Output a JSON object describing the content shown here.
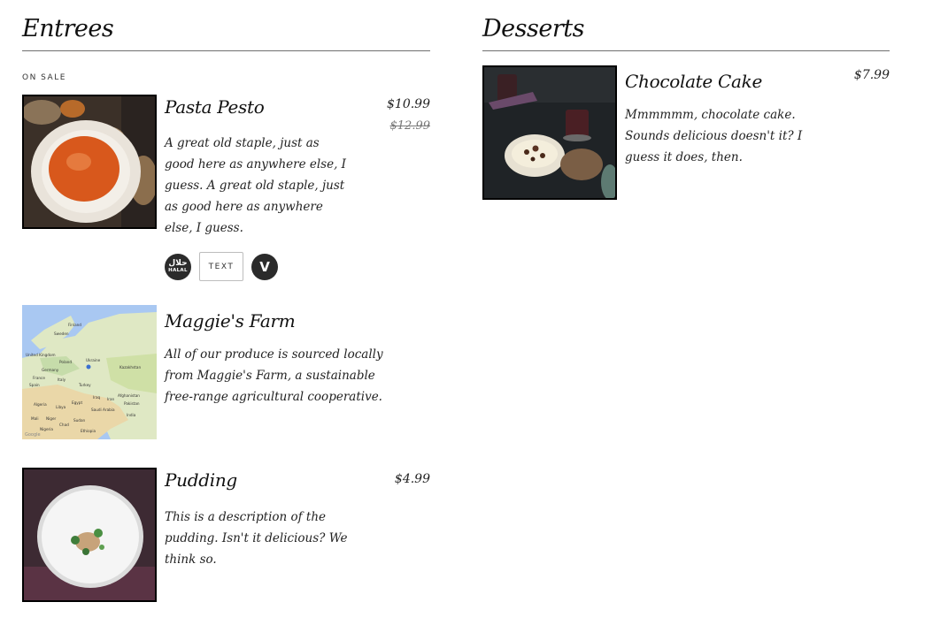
{
  "entrees": {
    "title": "Entrees",
    "tag": "ON SALE",
    "items": [
      {
        "name": "Pasta Pesto",
        "price": "$10.99",
        "old_price": "$12.99",
        "description": "A great old staple, just as good here as anywhere else, I guess. A great old staple, just as good here as anywhere else, I guess.",
        "badges": {
          "halal_arabic": "حلال",
          "halal_label": "HALAL",
          "text_label": "TEXT",
          "vegetarian_label": "V"
        }
      },
      {
        "name": "Maggie's Farm",
        "description": "All of our produce is sourced locally from Maggie's Farm, a sustainable free-range agricultural cooperative."
      },
      {
        "name": "Pudding",
        "price": "$4.99",
        "description": "This is a description of the pudding. Isn't it delicious? We think so."
      }
    ]
  },
  "desserts": {
    "title": "Desserts",
    "items": [
      {
        "name": "Chocolate Cake",
        "price": "$7.99",
        "description": "Mmmmmm, chocolate cake. Sounds delicious doesn't it? I guess it does, then."
      }
    ]
  },
  "map_labels": [
    "Finland",
    "Sweden",
    "United Kingdom",
    "Poland",
    "Germany",
    "Ukraine",
    "France",
    "Spain",
    "Italy",
    "Turkey",
    "Kazakhstan",
    "Afghanistan",
    "Iraq",
    "Iran",
    "Pakistan",
    "Algeria",
    "Libya",
    "Egypt",
    "Saudi Arabia",
    "India",
    "Mali",
    "Niger",
    "Chad",
    "Sudan",
    "Nigeria",
    "Ethiopia",
    "Google"
  ]
}
